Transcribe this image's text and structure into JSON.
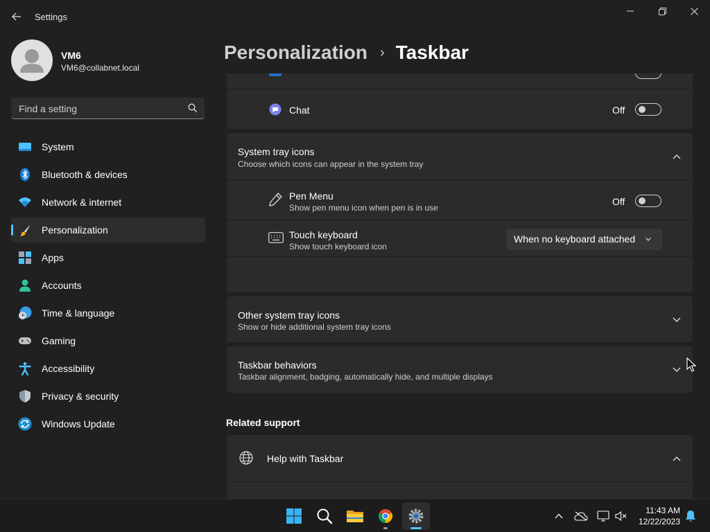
{
  "window": {
    "title": "Settings",
    "minimize_glyph": "—",
    "colors": {
      "background": "#202020",
      "card": "#2b2b2b",
      "accent": "#4cc2ff"
    }
  },
  "profile": {
    "name": "VM6",
    "email": "VM6@collabnet.local"
  },
  "search": {
    "placeholder": "Find a setting",
    "icon": "search-icon"
  },
  "sidebar": {
    "items": [
      {
        "label": "System",
        "icon": "system-icon",
        "active": false
      },
      {
        "label": "Bluetooth & devices",
        "icon": "bluetooth-icon",
        "active": false
      },
      {
        "label": "Network & internet",
        "icon": "wifi-icon",
        "active": false
      },
      {
        "label": "Personalization",
        "icon": "brush-icon",
        "active": true
      },
      {
        "label": "Apps",
        "icon": "apps-icon",
        "active": false
      },
      {
        "label": "Accounts",
        "icon": "accounts-icon",
        "active": false
      },
      {
        "label": "Time & language",
        "icon": "clock-globe-icon",
        "active": false
      },
      {
        "label": "Gaming",
        "icon": "gamepad-icon",
        "active": false
      },
      {
        "label": "Accessibility",
        "icon": "accessibility-icon",
        "active": false
      },
      {
        "label": "Privacy & security",
        "icon": "shield-icon",
        "active": false
      },
      {
        "label": "Windows Update",
        "icon": "update-icon",
        "active": false
      }
    ]
  },
  "header": {
    "parent": "Personalization",
    "separator": "›",
    "current": "Taskbar"
  },
  "content": {
    "chat": {
      "label": "Chat",
      "toggle_text": "Off",
      "on": false
    },
    "system_tray": {
      "title": "System tray icons",
      "subtitle": "Choose which icons can appear in the system tray",
      "expanded": true,
      "items": {
        "pen_menu": {
          "title": "Pen Menu",
          "subtitle": "Show pen menu icon when pen is in use",
          "toggle_text": "Off",
          "on": false
        },
        "touch_keyboard": {
          "title": "Touch keyboard",
          "subtitle": "Show touch keyboard icon",
          "selected": "When no keyboard attached"
        }
      }
    },
    "other_tray": {
      "title": "Other system tray icons",
      "subtitle": "Show or hide additional system tray icons",
      "expanded": false
    },
    "behaviors": {
      "title": "Taskbar behaviors",
      "subtitle": "Taskbar alignment, badging, automatically hide, and multiple displays",
      "expanded": false
    },
    "related_support": {
      "heading": "Related support",
      "help_title": "Help with Taskbar",
      "expanded": true
    }
  },
  "taskbar": {
    "apps": [
      "start-icon",
      "search-icon",
      "file-explorer-icon",
      "chrome-icon",
      "settings-icon"
    ],
    "clock": {
      "time": "11:43 AM",
      "date": "12/22/2023"
    },
    "tray": [
      "chevron-up-icon",
      "onedrive-offline-icon",
      "network-icon",
      "volume-muted-icon",
      "notification-bell-icon"
    ]
  }
}
